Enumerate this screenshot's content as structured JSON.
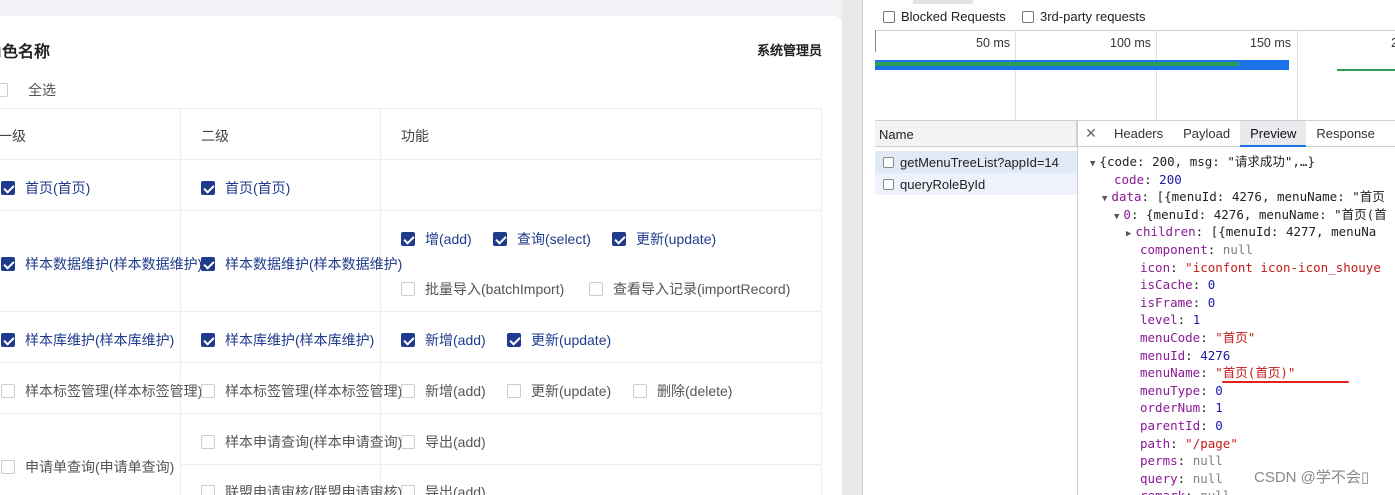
{
  "form": {
    "role_title": "角色名称",
    "role_value": "系统管理员",
    "select_all": "全选",
    "headers": [
      "一级",
      "二级",
      "功能"
    ]
  },
  "rows": {
    "r1": {
      "level1": "首页(首页)",
      "level2": "首页(首页)"
    },
    "r2": {
      "level1": "样本数据维护(样本数据维护)",
      "level2": "样本数据维护(样本数据维护)",
      "f1": "增(add)",
      "f2": "查询(select)",
      "f3": "更新(update)",
      "f4": "批量导入(batchImport)",
      "f5": "查看导入记录(importRecord)"
    },
    "r3": {
      "level1": "样本库维护(样本库维护)",
      "level2": "样本库维护(样本库维护)",
      "f1": "新增(add)",
      "f2": "更新(update)"
    },
    "r4": {
      "level1": "样本标签管理(样本标签管理)",
      "level2": "样本标签管理(样本标签管理)",
      "f1": "新增(add)",
      "f2": "更新(update)",
      "f3": "删除(delete)"
    },
    "r5": {
      "level1": "申请单查询(申请单查询)",
      "level2a": "样本申请查询(样本申请查询)",
      "fa": "导出(add)",
      "level2b": "联盟申请审核(联盟申请审核)",
      "fb": "导出(add)"
    }
  },
  "devtools": {
    "blocked": "Blocked Requests",
    "thirdparty": "3rd-party requests",
    "ticks": [
      "50 ms",
      "100 ms",
      "150 ms",
      "2"
    ],
    "name_header": "Name",
    "requests": [
      "getMenuTreeList?appId=14",
      "queryRoleById"
    ],
    "close": "✕",
    "tabs": [
      "Headers",
      "Payload",
      "Preview",
      "Response"
    ],
    "json": {
      "root": "{code: 200, msg: \"请求成功\",…}",
      "code_k": "code",
      "code_v": "200",
      "data_k": "data",
      "data_v": "[{menuId: 4276, menuName: \"首页",
      "i0_k": "0",
      "i0_v": "{menuId: 4276, menuName: \"首页(首",
      "children_k": "children",
      "children_v": "[{menuId: 4277, menuNa",
      "component_k": "component",
      "component_v": "null",
      "icon_k": "icon",
      "icon_v": "\"iconfont icon-icon_shouye",
      "isCache_k": "isCache",
      "isCache_v": "0",
      "isFrame_k": "isFrame",
      "isFrame_v": "0",
      "level_k": "level",
      "level_v": "1",
      "menuCode_k": "menuCode",
      "menuCode_v": "\"首页\"",
      "menuId_k": "menuId",
      "menuId_v": "4276",
      "menuName_k": "menuName",
      "menuName_v": "\"首页(首页)\"",
      "menuType_k": "menuType",
      "menuType_v": "0",
      "orderNum_k": "orderNum",
      "orderNum_v": "1",
      "parentId_k": "parentId",
      "parentId_v": "0",
      "path_k": "path",
      "path_v": "\"/page\"",
      "perms_k": "perms",
      "perms_v": "null",
      "query_k": "query",
      "query_v": "null",
      "remark_k": "remark",
      "remark_v": "null"
    }
  },
  "watermark": "CSDN @学不会▯",
  "colors": {
    "checked": "#1f3b8c",
    "json_key": "#8a1a96",
    "json_string": "#c41a16",
    "json_number": "#1a1aa6",
    "underline": "#e0231c"
  }
}
